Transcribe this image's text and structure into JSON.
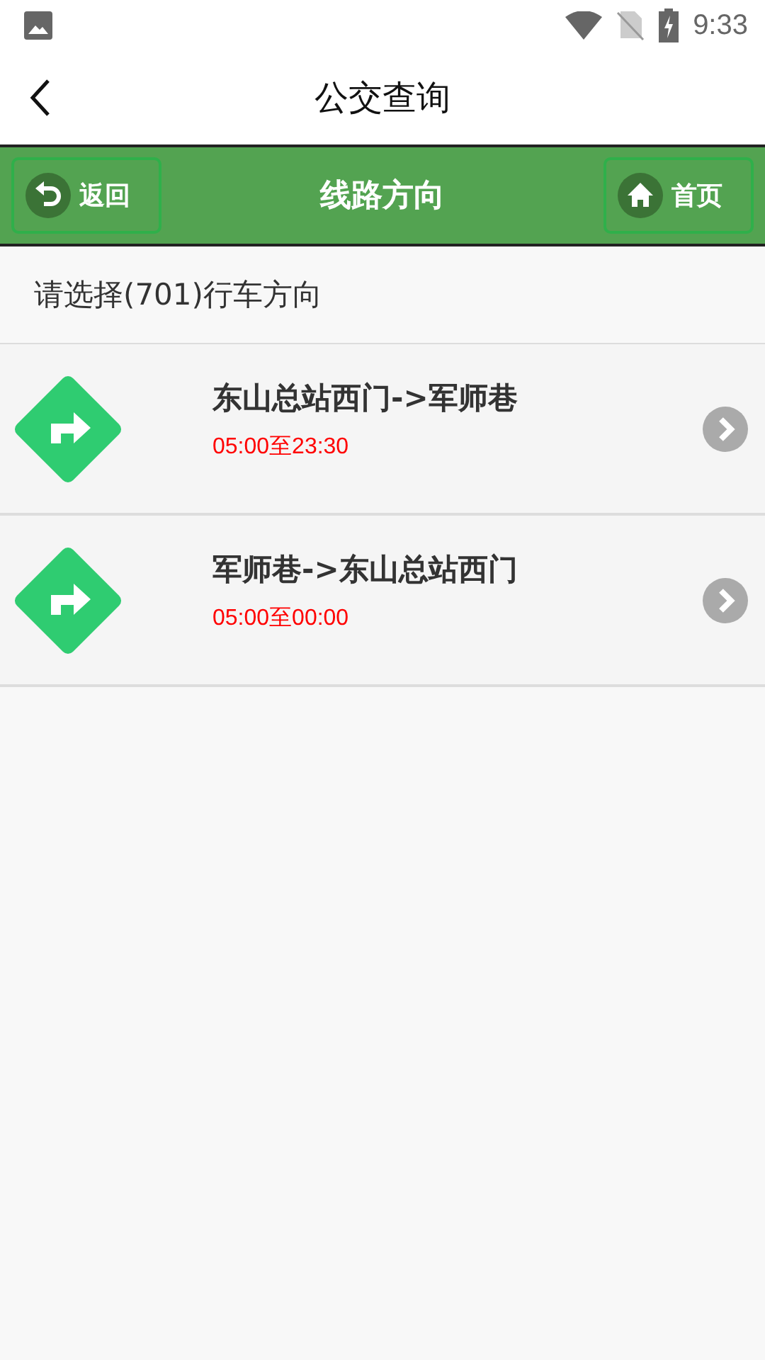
{
  "status_bar": {
    "time": "9:33"
  },
  "app_bar": {
    "title": "公交查询"
  },
  "toolbar": {
    "back_button": "返回",
    "title": "线路方向",
    "home_button": "首页"
  },
  "prompt": "请选择(701)行车方向",
  "directions": [
    {
      "route": "东山总站西门->军师巷",
      "hours": "05:00至23:30"
    },
    {
      "route": "军师巷->东山总站西门",
      "hours": "05:00至00:00"
    }
  ]
}
